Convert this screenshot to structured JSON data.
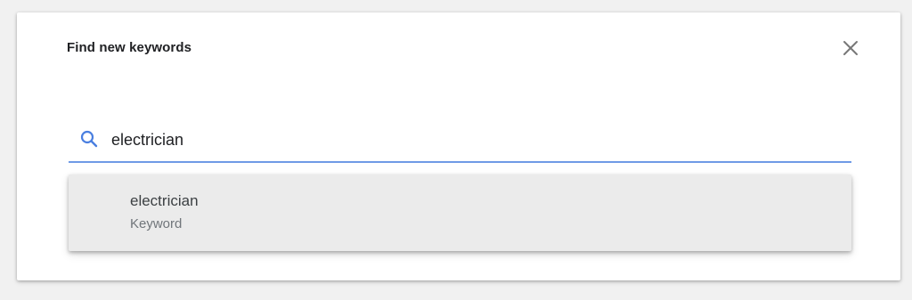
{
  "dialog": {
    "title": "Find new keywords",
    "close_icon": "close-icon"
  },
  "search": {
    "icon": "search-icon",
    "value": "electrician",
    "underline_color": "#6f9ae6"
  },
  "suggestions": [
    {
      "label": "electrician",
      "type": "Keyword"
    }
  ]
}
